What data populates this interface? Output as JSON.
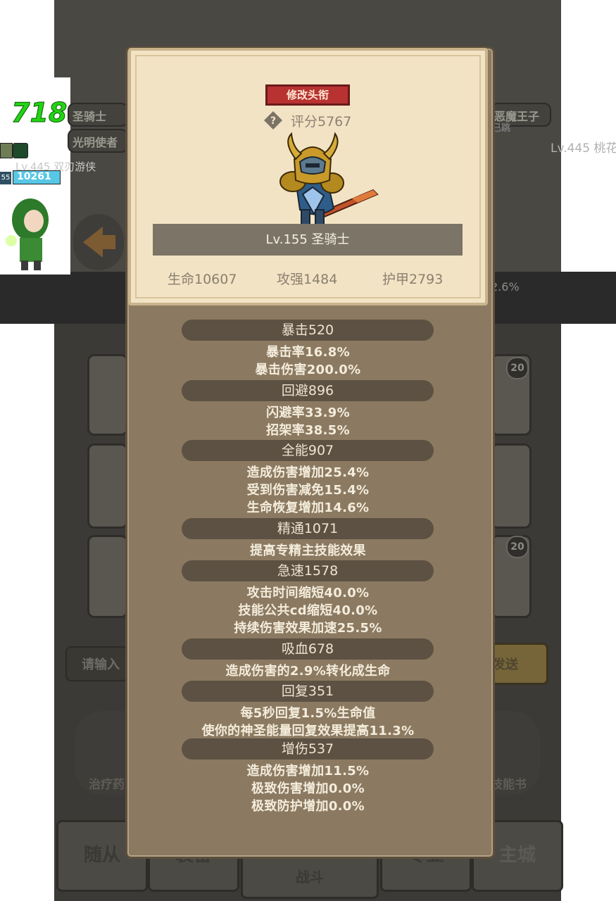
{
  "background": {
    "left_number": "718",
    "left_labels": [
      "圣骑士",
      "光明使者"
    ],
    "left_player": "Lv.445 双刃游侠",
    "left_hp_value": "10261",
    "left_level_badge": "55",
    "right_label": "恶魔王子",
    "right_sub": "已跳",
    "right_player": "Lv.445 桃花",
    "right_percent": "2.6%",
    "input_placeholder": "请输入",
    "send_label": "发送",
    "bag_labels": [
      "治疗药",
      "技能书"
    ],
    "badge_20": "20",
    "bottom_nav": [
      "随从",
      "装备",
      "战斗",
      "专业",
      "主城"
    ]
  },
  "modal": {
    "edit_title_label": "修改头衔",
    "score": "评分5767",
    "name_level": "Lv.155 圣骑士",
    "base_stats": [
      "生命10607",
      "攻强1484",
      "护甲2793"
    ],
    "stat_groups": [
      {
        "header": "暴击520",
        "lines": [
          "暴击率16.8%",
          "暴击伤害200.0%"
        ]
      },
      {
        "header": "回避896",
        "lines": [
          "闪避率33.9%",
          "招架率38.5%"
        ]
      },
      {
        "header": "全能907",
        "lines": [
          "造成伤害增加25.4%",
          "受到伤害减免15.4%",
          "生命恢复增加14.6%"
        ]
      },
      {
        "header": "精通1071",
        "lines": [
          "提高专精主技能效果"
        ]
      },
      {
        "header": "急速1578",
        "lines": [
          "攻击时间缩短40.0%",
          "技能公共cd缩短40.0%",
          "持续伤害效果加速25.5%"
        ]
      },
      {
        "header": "吸血678",
        "lines": [
          "造成伤害的2.9%转化成生命"
        ]
      },
      {
        "header": "回复351",
        "lines": [
          "每5秒回复1.5%生命值",
          "使你的神圣能量回复效果提高11.3%"
        ]
      },
      {
        "header": "增伤537",
        "lines": [
          "造成伤害增加11.5%",
          "极致伤害增加0.0%",
          "极致防护增加0.0%"
        ]
      }
    ]
  },
  "colors": {
    "panel": "#8b7a61",
    "card": "#f2e3c4",
    "accent_red": "#b83232",
    "stat_pill": "#5d5143"
  }
}
